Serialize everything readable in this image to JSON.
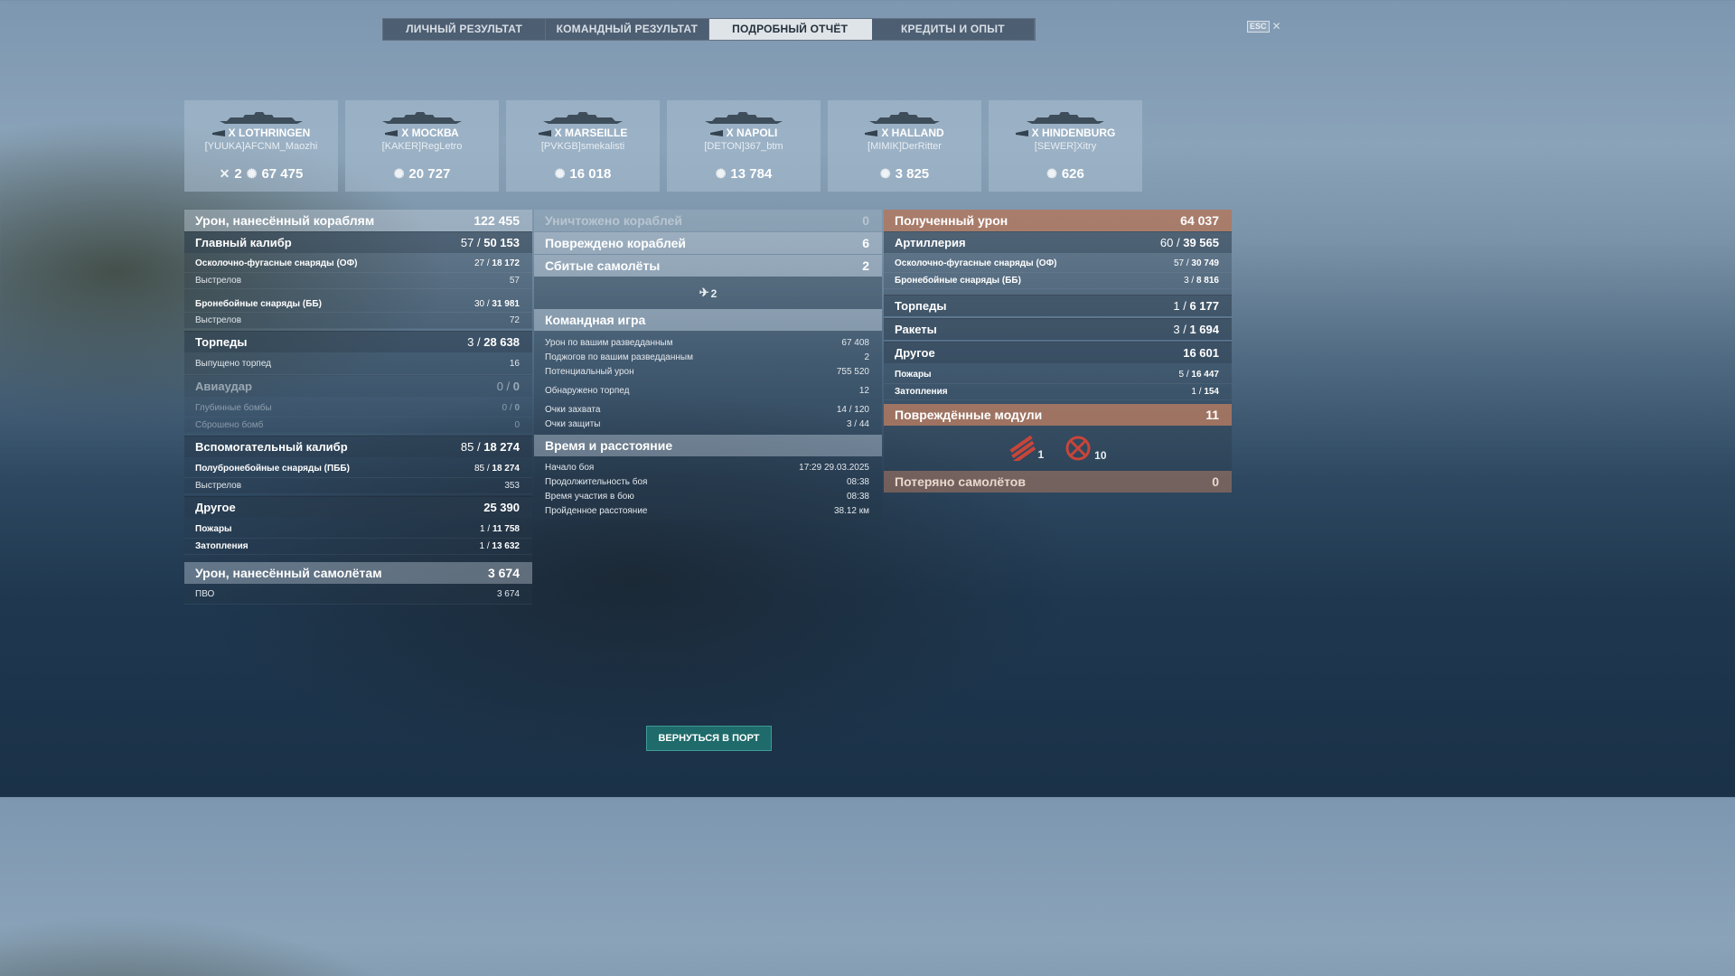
{
  "tabs": [
    "ЛИЧНЫЙ РЕЗУЛЬТАТ",
    "КОМАНДНЫЙ РЕЗУЛЬТАТ",
    "ПОДРОБНЫЙ ОТЧЁТ",
    "КРЕДИТЫ И ОПЫТ"
  ],
  "esc": {
    "key": "ESC",
    "close": "✕"
  },
  "cards": [
    {
      "ship": "X LOTHRINGEN",
      "player": "[YUUKA]AFCNM_Maozhi",
      "kills": "2",
      "damage": "67 475"
    },
    {
      "ship": "X МОСКВА",
      "player": "[KAKER]RegLetro",
      "damage": "20 727"
    },
    {
      "ship": "X MARSEILLE",
      "player": "[PVKGB]smekalisti",
      "damage": "16 018"
    },
    {
      "ship": "X NAPOLI",
      "player": "[DETON]367_btm",
      "damage": "13 784"
    },
    {
      "ship": "X HALLAND",
      "player": "[MIMIK]DerRitter",
      "damage": "3 825"
    },
    {
      "ship": "X HINDENBURG",
      "player": "[SEWER]Xitry",
      "damage": "626"
    }
  ],
  "left": {
    "dmg_ships": {
      "label": "Урон, нанесённый кораблям",
      "value": "122 455"
    },
    "main": {
      "label": "Главный калибр",
      "a": "57",
      "b": "50 153"
    },
    "he": {
      "label": "Осколочно-фугасные снаряды (ОФ)",
      "a": "27",
      "b": "18 172"
    },
    "he_shots": {
      "label": "Выстрелов",
      "value": "57"
    },
    "ap": {
      "label": "Бронебойные снаряды (ББ)",
      "a": "30",
      "b": "31 981"
    },
    "ap_shots": {
      "label": "Выстрелов",
      "value": "72"
    },
    "torp": {
      "label": "Торпеды",
      "a": "3",
      "b": "28 638"
    },
    "torp_fired": {
      "label": "Выпущено торпед",
      "value": "16"
    },
    "air": {
      "label": "Авиаудар",
      "a": "0",
      "b": "0"
    },
    "depth": {
      "label": "Глубинные бомбы",
      "a": "0",
      "b": "0"
    },
    "bombs": {
      "label": "Сброшено бомб",
      "value": "0"
    },
    "sec": {
      "label": "Вспомогательный калибр",
      "a": "85",
      "b": "18 274"
    },
    "sap": {
      "label": "Полубронебойные снаряды (ПББ)",
      "a": "85",
      "b": "18 274"
    },
    "sec_shots": {
      "label": "Выстрелов",
      "value": "353"
    },
    "other": {
      "label": "Другое",
      "value": "25 390"
    },
    "fires": {
      "label": "Пожары",
      "a": "1",
      "b": "11 758"
    },
    "floods": {
      "label": "Затопления",
      "a": "1",
      "b": "13 632"
    },
    "dmg_planes": {
      "label": "Урон, нанесённый самолётам",
      "value": "3 674"
    },
    "aa": {
      "label": "ПВО",
      "value": "3 674"
    }
  },
  "mid": {
    "destroyed": {
      "label": "Уничтожено кораблей",
      "value": "0"
    },
    "damaged": {
      "label": "Повреждено кораблей",
      "value": "6"
    },
    "planes": {
      "label": "Сбитые самолёты",
      "value": "2"
    },
    "planes_icon_count": "2",
    "team_title": "Командная игра",
    "team": [
      {
        "label": "Урон по вашим разведданным",
        "value": "67 408"
      },
      {
        "label": "Поджогов по вашим разведданным",
        "value": "2"
      },
      {
        "label": "Потенциальный урон",
        "value": "755 520"
      },
      {
        "label": "Обнаружено торпед",
        "value": "12"
      },
      {
        "label": "Очки захвата",
        "value": "14 / 120"
      },
      {
        "label": "Очки защиты",
        "value": "3 / 44"
      }
    ],
    "time_title": "Время и расстояние",
    "time": [
      {
        "label": "Начало боя",
        "value": "17:29  29.03.2025"
      },
      {
        "label": "Продолжительность боя",
        "value": "08:38"
      },
      {
        "label": "Время участия в бою",
        "value": "08:38"
      },
      {
        "label": "Пройденное расстояние",
        "value": "38.12 км"
      }
    ]
  },
  "right": {
    "received": {
      "label": "Полученный урон",
      "value": "64 037"
    },
    "art": {
      "label": "Артиллерия",
      "a": "60",
      "b": "39 565"
    },
    "he": {
      "label": "Осколочно-фугасные снаряды (ОФ)",
      "a": "57",
      "b": "30 749"
    },
    "ap": {
      "label": "Бронебойные снаряды (ББ)",
      "a": "3",
      "b": "8 816"
    },
    "torp": {
      "label": "Торпеды",
      "a": "1",
      "b": "6 177"
    },
    "rockets": {
      "label": "Ракеты",
      "a": "3",
      "b": "1 694"
    },
    "other": {
      "label": "Другое",
      "value": "16 601"
    },
    "fires": {
      "label": "Пожары",
      "a": "5",
      "b": "16 447"
    },
    "floods": {
      "label": "Затопления",
      "a": "1",
      "b": "154"
    },
    "modules": {
      "label": "Повреждённые модули",
      "value": "11",
      "icon1_count": "1",
      "icon2_count": "10"
    },
    "lost_planes": {
      "label": "Потеряно самолётов",
      "value": "0"
    }
  },
  "button": "ВЕРНУТЬСЯ В ПОРТ",
  "colors": {
    "accent_orange": "#af785f",
    "button_teal": "#1f6a6a"
  }
}
